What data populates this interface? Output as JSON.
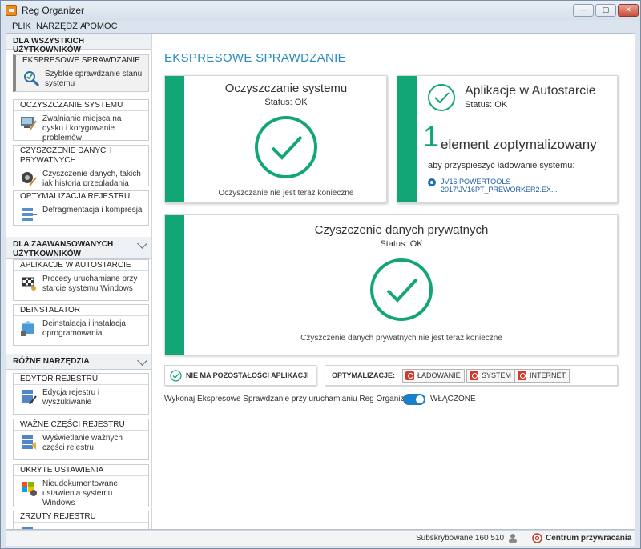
{
  "window": {
    "title": "Reg Organizer"
  },
  "menu": {
    "items": [
      "PLIK",
      "NARZĘDZIA",
      "POMOC"
    ]
  },
  "sidebar": {
    "sections": [
      {
        "label": "DLA WSZYSTKICH UŻYTKOWNIKÓW"
      },
      {
        "label": "DLA ZAAWANSOWANYCH UŻYTKOWNIKÓW"
      },
      {
        "label": "RÓŻNE NARZĘDZIA"
      }
    ],
    "items": [
      {
        "title": "EKSPRESOWE SPRAWDZANIE",
        "desc": "Szybkie sprawdzanie stanu systemu",
        "icon": "magnifier-check-icon"
      },
      {
        "title": "OCZYSZCZANIE SYSTEMU",
        "desc": "Zwalnianie miejsca na dysku i korygowanie problemów",
        "icon": "broom-monitor-icon"
      },
      {
        "title": "CZYSZCZENIE DANYCH PRYWATNYCH",
        "desc": "Czyszczenie danych, takich jak historia przeglądania",
        "icon": "privacy-broom-icon"
      },
      {
        "title": "OPTYMALIZACJA REJESTRU",
        "desc": "Defragmentacja i kompresja",
        "icon": "registry-optimize-icon"
      },
      {
        "title": "APLIKACJE W AUTOSTARCIE",
        "desc": "Procesy uruchamiane przy starcie systemu Windows",
        "icon": "race-flag-icon"
      },
      {
        "title": "DEINSTALATOR",
        "desc": "Deinstalacja i instalacja oprogramowania",
        "icon": "uninstall-box-icon"
      },
      {
        "title": "EDYTOR REJESTRU",
        "desc": "Edycja rejestru i wyszukiwanie",
        "icon": "registry-editor-icon"
      },
      {
        "title": "WAŻNE CZĘŚCI REJESTRU",
        "desc": "Wyświetlanie ważnych części rejestru",
        "icon": "registry-parts-icon"
      },
      {
        "title": "UKRYTE USTAWIENIA",
        "desc": "Nieudokumentowane ustawienia systemu Windows",
        "icon": "windows-gear-icon"
      },
      {
        "title": "ZRZUTY REJESTRU",
        "desc": "",
        "icon": "registry-snapshot-icon"
      }
    ]
  },
  "main": {
    "title": "EKSPRESOWE SPRAWDZANIE",
    "card_cleanup": {
      "title": "Oczyszczanie systemu",
      "status": "Status: OK",
      "note": "Oczyszczanie nie jest teraz konieczne"
    },
    "card_autostart": {
      "title": "Aplikacje w Autostarcie",
      "status": "Status: OK",
      "count": "1",
      "count_text": "element zoptymalizowany",
      "sub": "aby przyspieszyć ładowanie systemu:",
      "entry": "JV16 POWERTOOLS 2017\\JV16PT_PREWORKER2.EX..."
    },
    "card_private": {
      "title": "Czyszczenie danych prywatnych",
      "status": "Status: OK",
      "note": "Czyszczenie danych prywatnych nie jest teraz konieczne"
    },
    "leftovers": "NIE MA POZOSTAŁOŚCI APLIKACJI",
    "optim_label": "OPTYMALIZACJE:",
    "optim_buttons": [
      "ŁADOWANIE",
      "SYSTEM",
      "INTERNET"
    ],
    "autorun_text": "Wykonaj Ekspresowe Sprawdzanie przy uruchamianiu Reg Organizer",
    "toggle_state": "WŁĄCZONE"
  },
  "statusbar": {
    "subscribed": "Subskrybowane 160 510",
    "rescue": "Centrum przywracania"
  },
  "colors": {
    "accent_green": "#12a676",
    "title_blue": "#2a8bbf",
    "toggle_blue": "#1a7fc9",
    "power_red": "#d23a2e"
  }
}
